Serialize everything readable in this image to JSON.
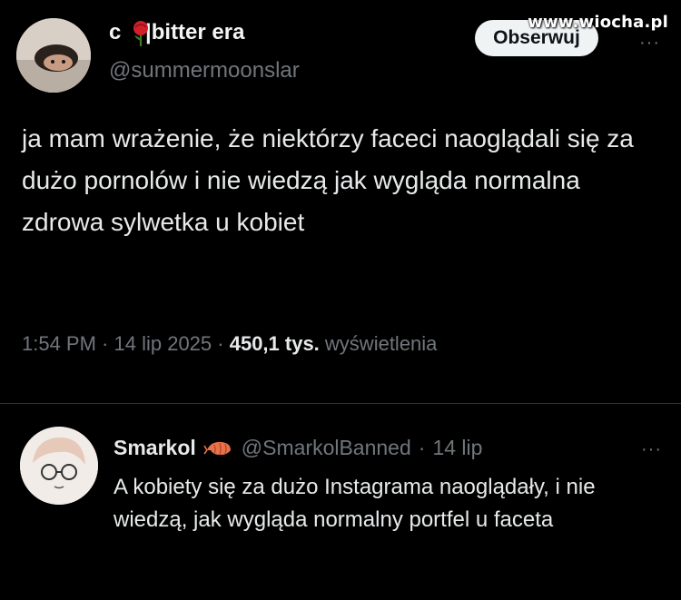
{
  "watermark": "www.wiocha.pl",
  "tweet": {
    "display_name": "c    |bitter era",
    "handle": "@summermoonslar",
    "follow_label": "Obserwuj",
    "more_label": "···",
    "text": "ja mam wrażenie, że niektórzy faceci naoglądali się za dużo pornolów i nie wiedzą jak wygląda normalna zdrowa  sylwetka u kobiet",
    "time": "1:54 PM",
    "date": "14 lip 2025",
    "views_count": "450,1 tys.",
    "views_label": "wyświetlenia",
    "separator": " · "
  },
  "reply": {
    "display_name": "Smarkol",
    "handle": "@SmarkolBanned",
    "date": "14 lip",
    "separator": " · ",
    "more_label": "···",
    "text": "A kobiety się za dużo Instagrama naoglądały, i nie wiedzą, jak wygląda normalny portfel u faceta"
  },
  "icons": {
    "name_emoji": "rose-icon",
    "reply_emoji": "shrimp-icon"
  },
  "colors": {
    "background": "#000000",
    "text": "#e7e9ea",
    "muted": "#71767b",
    "follow_bg": "#eff3f4",
    "divider": "#2f3336"
  }
}
